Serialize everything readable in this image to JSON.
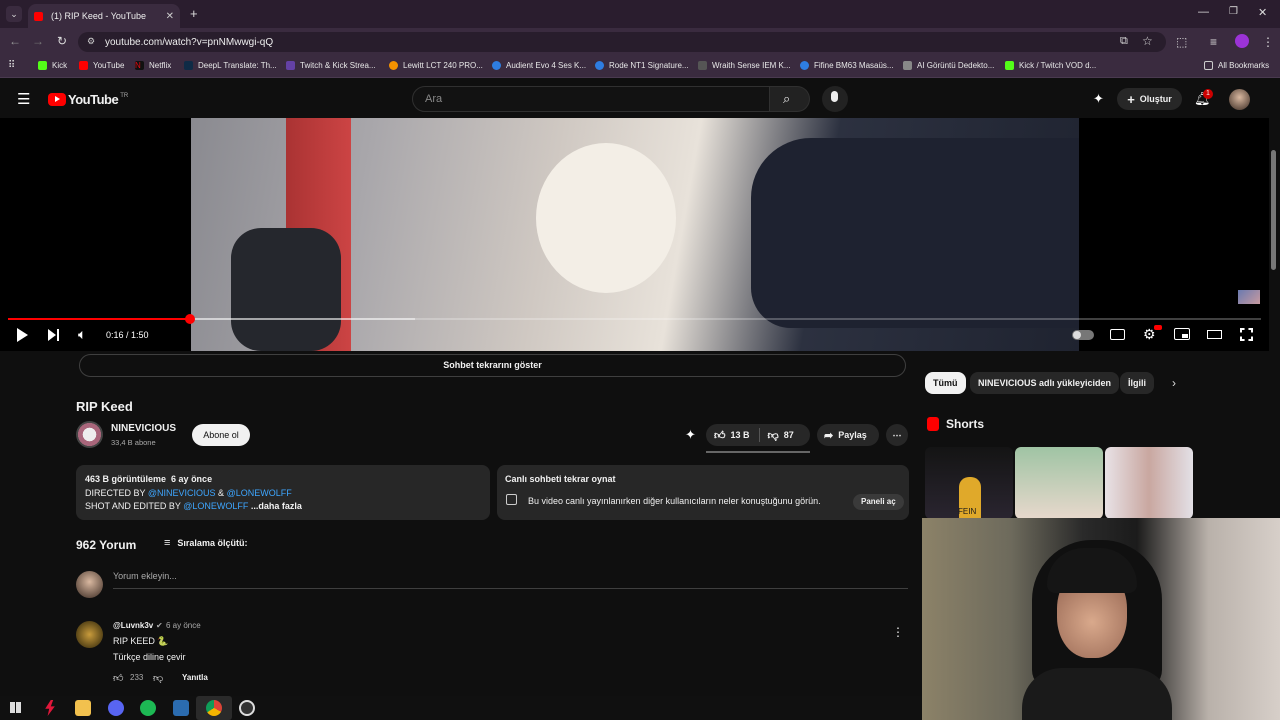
{
  "browser": {
    "tab_title": "(1) RIP Keed - YouTube",
    "new_tab": "+",
    "url": "youtube.com/watch?v=pnNMwwgi-qQ",
    "bookmarks": [
      "Kick",
      "YouTube",
      "Netflix",
      "DeepL Translate: Th...",
      "Twitch & Kick Strea...",
      "Lewitt LCT 240 PRO...",
      "Audient Evo 4 Ses K...",
      "Rode NT1 Signature...",
      "Wraith Sense IEM K...",
      "Fifine BM63 Masaüs...",
      "AI Görüntü Dedekto...",
      "Kick / Twitch VOD d..."
    ],
    "all_bookmarks": "All Bookmarks"
  },
  "header": {
    "logo": "YouTube",
    "logo_region": "TR",
    "search_placeholder": "Ara",
    "create_label": "Oluştur",
    "notification_count": "1"
  },
  "player": {
    "time": "0:16 / 1:50",
    "progress_fraction": 0.145,
    "buffered_fraction": 0.325
  },
  "chat_replay_button": "Sohbet tekrarını göster",
  "video": {
    "title": "RIP Keed",
    "channel": "NINEVICIOUS",
    "subscribers": "33,4 B abone",
    "subscribe": "Abone ol",
    "likes": "13 B",
    "dislikes": "87",
    "share": "Paylaş"
  },
  "description": {
    "views": "463 B görüntüleme",
    "age": "6 ay önce",
    "line2_prefix": "DIRECTED BY",
    "mention1": "@NINEVICIOUS",
    "amp": "&",
    "mention2": "@LONEWOLFF",
    "line3_prefix": "SHOT AND EDITED BY",
    "mention3": "@LONEWOLFF",
    "more": "...daha fazla"
  },
  "live_chat": {
    "title": "Canlı sohbeti tekrar oynat",
    "text": "Bu video canlı yayınlanırken diğer kullanıcıların neler konuştuğunu görün.",
    "button": "Paneli aç"
  },
  "comments": {
    "count": "962 Yorum",
    "sort": "Sıralama ölçütü:",
    "add_placeholder": "Yorum ekleyin...",
    "items": [
      {
        "author": "@Luvnk3v",
        "age": "6 ay önce",
        "text": "RIP KEED 🐍",
        "translate": "Türkçe diline çevir",
        "likes": "233",
        "reply": "Yanıtla"
      }
    ]
  },
  "sidebar": {
    "chips": [
      "Tümü",
      "NINEVICIOUS adlı yükleyiciden",
      "İlgili"
    ],
    "shorts_title": "Shorts",
    "short1_text": "FEIN"
  },
  "colors": {
    "accent": "#ff0000",
    "link": "#3ea6ff",
    "bg": "#0f0f0f"
  }
}
